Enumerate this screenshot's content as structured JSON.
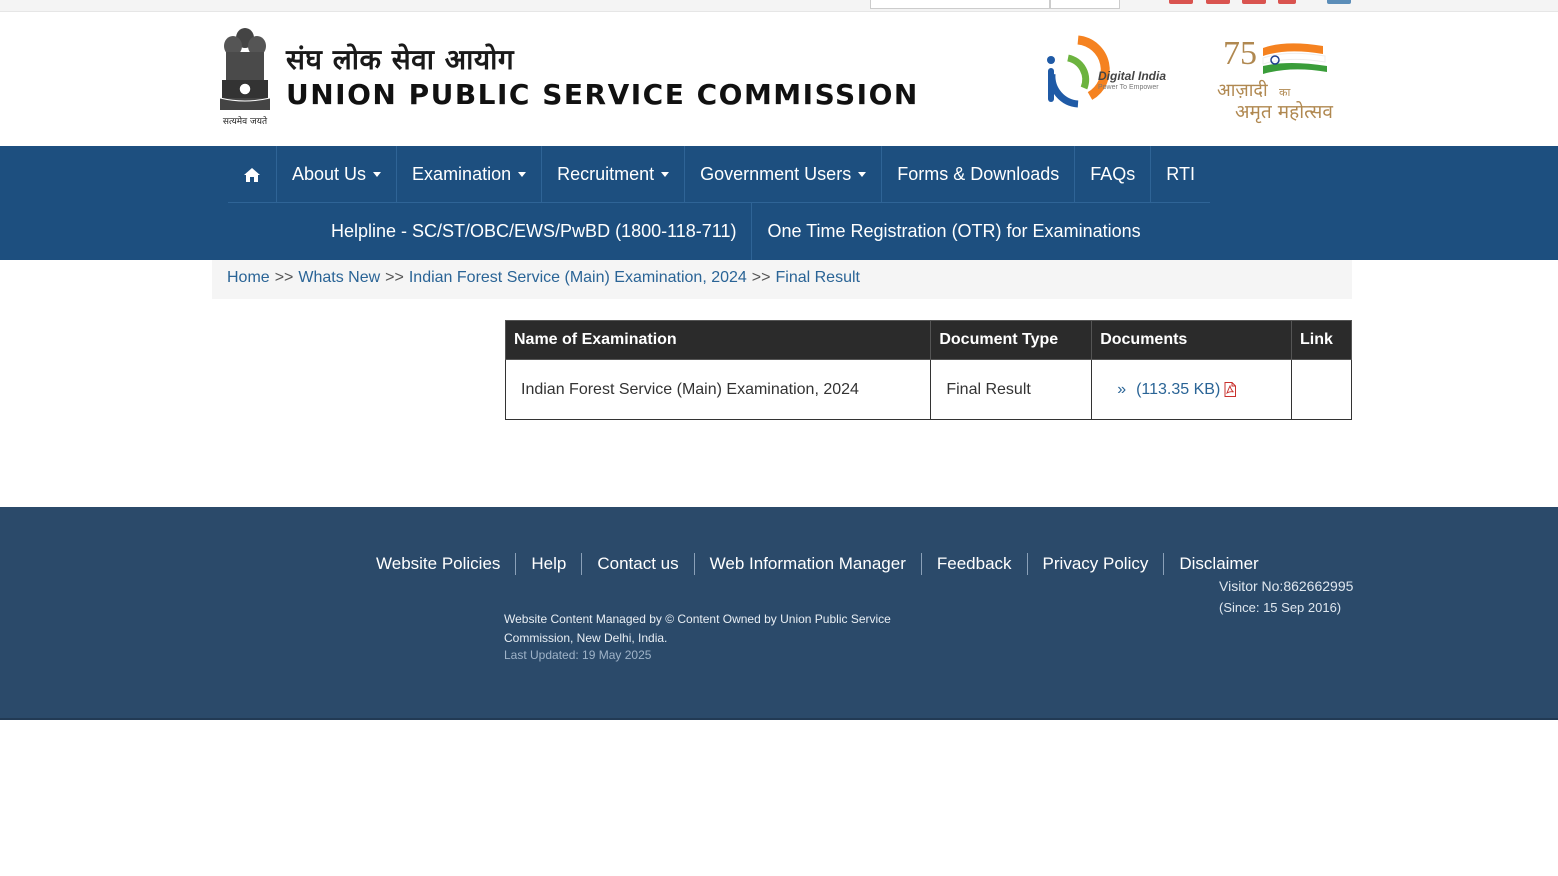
{
  "header": {
    "emblem_caption": "सत्यमेव जयते",
    "title_hindi": "संघ लोक सेवा आयोग",
    "title_english": "UNION PUBLIC SERVICE COMMISSION",
    "digital_india": {
      "name": "Digital India",
      "tagline": "Power To Empower"
    },
    "azadi_logo": {
      "text_line1": "आज़ादी",
      "text_small": "का",
      "text_line2": "अमृत महोत्सव",
      "number": "75"
    }
  },
  "nav": {
    "row1": [
      {
        "label": "",
        "icon": "home-icon"
      },
      {
        "label": "About Us",
        "dropdown": true
      },
      {
        "label": "Examination",
        "dropdown": true
      },
      {
        "label": "Recruitment",
        "dropdown": true
      },
      {
        "label": "Government Users",
        "dropdown": true
      },
      {
        "label": "Forms & Downloads",
        "dropdown": false
      },
      {
        "label": "FAQs",
        "dropdown": false
      },
      {
        "label": "RTI",
        "dropdown": false
      }
    ],
    "row2": [
      {
        "label": "Helpline - SC/ST/OBC/EWS/PwBD (1800-118-711)"
      },
      {
        "label": "One Time Registration (OTR) for Examinations"
      }
    ]
  },
  "breadcrumb": {
    "items": [
      "Home",
      "Whats New",
      "Indian Forest Service (Main) Examination, 2024",
      "Final Result"
    ],
    "separator": ">>"
  },
  "table": {
    "headers": [
      "Name of Examination",
      "Document Type",
      "Documents",
      "Link"
    ],
    "rows": [
      {
        "name": "Indian Forest Service (Main) Examination, 2024",
        "doc_type": "Final Result",
        "doc_marker": "»",
        "doc_size": "(113.35 KB)",
        "doc_icon": "pdf-icon",
        "link": ""
      }
    ]
  },
  "footer": {
    "links": [
      "Website Policies",
      "Help",
      "Contact us",
      "Web Information Manager",
      "Feedback",
      "Privacy Policy",
      "Disclaimer"
    ],
    "content_note": "Website Content Managed by © Content Owned by Union Public Service Commission, New Delhi, India.",
    "last_updated": "Last Updated: 19 May 2025",
    "visitor_label": "Visitor No:862662995",
    "visitor_since": "(Since: 15 Sep 2016)"
  },
  "colors": {
    "nav_bg": "#1d4f7f",
    "footer_bg": "#2b4a6a",
    "link": "#2a6496",
    "table_header_bg": "#2b2b2b"
  }
}
